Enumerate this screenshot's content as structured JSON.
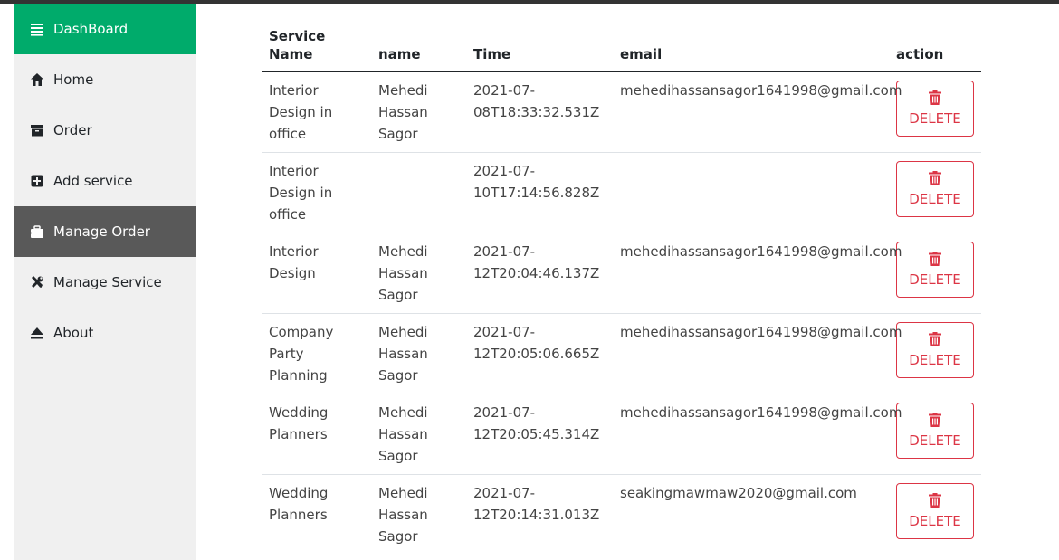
{
  "sidebar": {
    "brand": {
      "label": "DashBoard",
      "icon": "menu-icon"
    },
    "items": [
      {
        "label": "Home",
        "icon": "home-icon"
      },
      {
        "label": "Order",
        "icon": "archive-icon"
      },
      {
        "label": "Add service",
        "icon": "plus-square-icon"
      },
      {
        "label": "Manage Order",
        "icon": "toolbox-icon",
        "active": true
      },
      {
        "label": "Manage Service",
        "icon": "tools-icon"
      },
      {
        "label": "About",
        "icon": "eject-icon"
      }
    ]
  },
  "table": {
    "headers": {
      "service": "Service Name",
      "name": "name",
      "time": "Time",
      "email": "email",
      "action": "action"
    },
    "delete_label": "DELETE",
    "rows": [
      {
        "service": "Interior Design in office",
        "name": "Mehedi Hassan Sagor",
        "time": "2021-07-08T18:33:32.531Z",
        "email": "mehedihassansagor1641998@gmail.com"
      },
      {
        "service": "Interior Design in office",
        "name": "",
        "time": "2021-07-10T17:14:56.828Z",
        "email": ""
      },
      {
        "service": "Interior Design",
        "name": "Mehedi Hassan Sagor",
        "time": "2021-07-12T20:04:46.137Z",
        "email": "mehedihassansagor1641998@gmail.com"
      },
      {
        "service": "Company Party Planning",
        "name": "Mehedi Hassan Sagor",
        "time": "2021-07-12T20:05:06.665Z",
        "email": "mehedihassansagor1641998@gmail.com"
      },
      {
        "service": "Wedding Planners",
        "name": "Mehedi Hassan Sagor",
        "time": "2021-07-12T20:05:45.314Z",
        "email": "mehedihassansagor1641998@gmail.com"
      },
      {
        "service": "Wedding Planners",
        "name": "Mehedi Hassan Sagor",
        "time": "2021-07-12T20:14:31.013Z",
        "email": "seakingmawmaw2020@gmail.com"
      }
    ]
  },
  "colors": {
    "brand": "#00ab6b",
    "active": "#595959",
    "danger": "#dc3545",
    "sidebar_bg": "#f0f0f0"
  }
}
